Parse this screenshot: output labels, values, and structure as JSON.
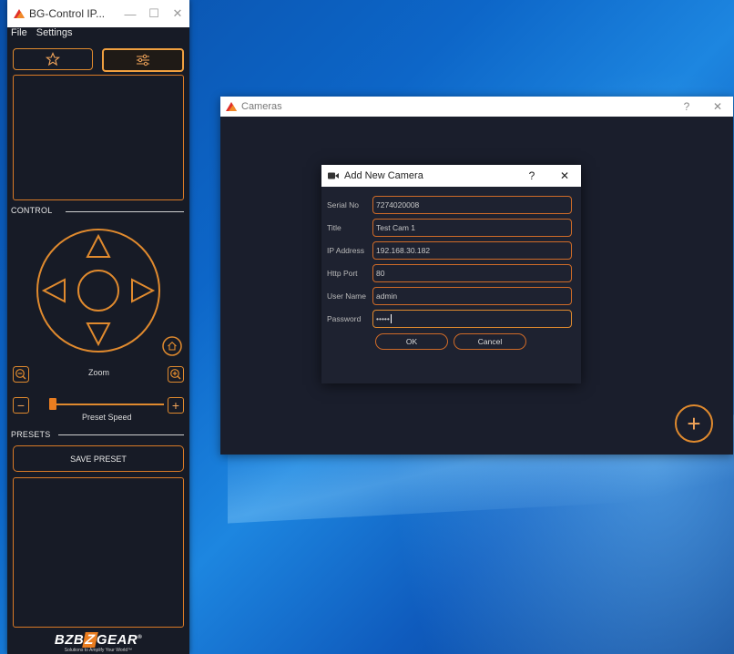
{
  "colors": {
    "accent": "#e08a2e",
    "panel_bg": "#171b26",
    "dialog_bg": "#1e2230"
  },
  "main_window": {
    "title": "BG-Control IP...",
    "controls": {
      "minimize": "—",
      "maximize": "☐",
      "close": "✕"
    },
    "menu": [
      "File",
      "Settings"
    ],
    "tabs": [
      {
        "icon": "star-icon",
        "active": false
      },
      {
        "icon": "sliders-icon",
        "active": true
      }
    ],
    "control_label": "CONTROL",
    "zoom_label": "Zoom",
    "speed_label": "Preset Speed",
    "preset_speed_level": 0.05,
    "presets_label": "PRESETS",
    "save_preset_label": "SAVE PRESET",
    "logo": {
      "brand_left": "BZB",
      "brand_right": "GEAR",
      "tagline": "Solutions to Amplify Your World™"
    }
  },
  "cameras_window": {
    "title": "Cameras",
    "controls": {
      "help": "?",
      "close": "✕"
    },
    "add_button": "+"
  },
  "dialog": {
    "title": "Add New Camera",
    "controls": {
      "help": "?",
      "close": "✕"
    },
    "fields": [
      {
        "label": "Serial No",
        "value": "7274020008"
      },
      {
        "label": "Title",
        "value": "Test Cam 1"
      },
      {
        "label": "IP Address",
        "value": "192.168.30.182"
      },
      {
        "label": "Http Port",
        "value": "80"
      },
      {
        "label": "User Name",
        "value": "admin"
      },
      {
        "label": "Password",
        "value": "•••••"
      }
    ],
    "ok_label": "OK",
    "cancel_label": "Cancel"
  }
}
